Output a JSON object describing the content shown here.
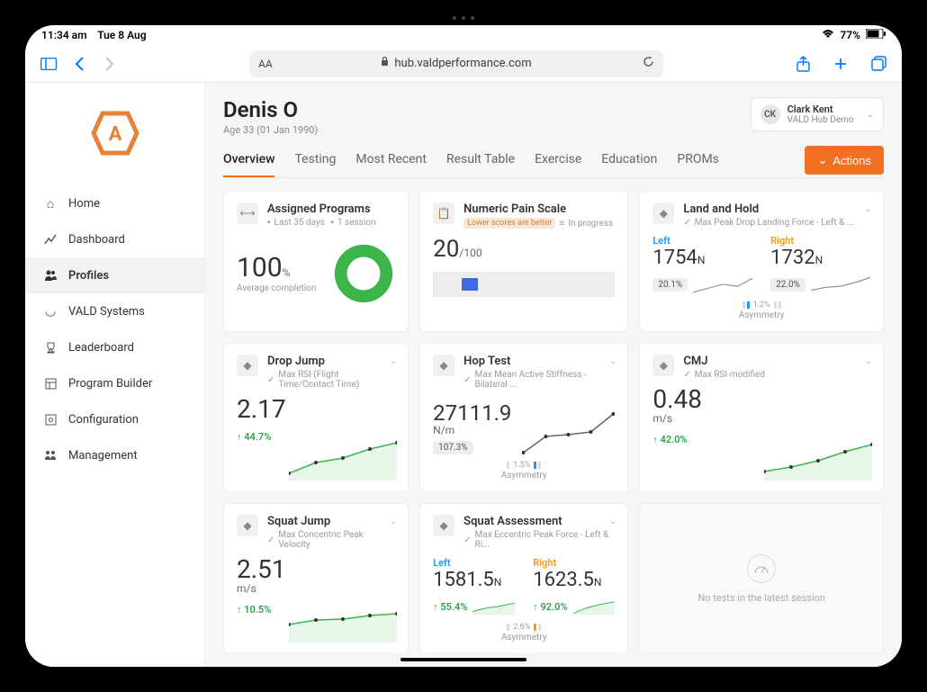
{
  "status": {
    "time": "11:34 am",
    "date": "Tue 8 Aug",
    "battery": "77%"
  },
  "browser": {
    "url": "hub.valdperformance.com",
    "aa": "AA"
  },
  "sidebar": {
    "items": [
      {
        "label": "Home",
        "icon": "home"
      },
      {
        "label": "Dashboard",
        "icon": "chart"
      },
      {
        "label": "Profiles",
        "icon": "user",
        "active": true
      },
      {
        "label": "VALD Systems",
        "icon": "device"
      },
      {
        "label": "Leaderboard",
        "icon": "trophy"
      },
      {
        "label": "Program Builder",
        "icon": "layout"
      },
      {
        "label": "Configuration",
        "icon": "gear"
      },
      {
        "label": "Management",
        "icon": "people"
      }
    ]
  },
  "header": {
    "profile_name": "Denis O",
    "age_line": "Age  33 (01 Jan 1990)",
    "user": {
      "initials": "CK",
      "name": "Clark Kent",
      "sub": "VALD Hub Demo"
    }
  },
  "tabs": [
    "Overview",
    "Testing",
    "Most Recent",
    "Result Table",
    "Exercise",
    "Education",
    "PROMs"
  ],
  "actions_label": "Actions",
  "cards": {
    "assigned": {
      "title": "Assigned Programs",
      "sub1": "Last 35 days",
      "sub2": "1 session",
      "value": "100",
      "unit": "%",
      "avg": "Average completion"
    },
    "pain": {
      "title": "Numeric Pain Scale",
      "sub1": "Lower scores are better",
      "sub2": "In progress",
      "score": "20",
      "max": "/100"
    },
    "land": {
      "title": "Land and Hold",
      "sub": "Max Peak Drop Landing Force - Left & ...",
      "left_label": "Left",
      "left_val": "1754",
      "left_unit": "N",
      "left_pct": "20.1%",
      "right_label": "Right",
      "right_val": "1732",
      "right_unit": "N",
      "right_pct": "22.0%",
      "asym": "1.2%",
      "asym_label": "Asymmetry"
    },
    "drop": {
      "title": "Drop Jump",
      "sub": "Max RSI (Flight Time/Contact Time)",
      "val": "2.17",
      "change": "↑ 44.7%"
    },
    "hop": {
      "title": "Hop Test",
      "sub": "Max Mean Active Stiffness - Bilateral ...",
      "val": "27111.9",
      "unit": "N/m",
      "pill": "107.3%",
      "asym": "1.5%",
      "asym_label": "Asymmetry"
    },
    "cmj": {
      "title": "CMJ",
      "sub": "Max RSI-modified",
      "val": "0.48",
      "unit": "m/s",
      "change": "↑ 42.0%"
    },
    "squatjump": {
      "title": "Squat Jump",
      "sub": "Max Concentric Peak Velocity",
      "val": "2.51",
      "unit": "m/s",
      "change": "↑ 10.5%"
    },
    "squatassess": {
      "title": "Squat Assessment",
      "sub": "Max Eccentric Peak Force - Left & Ri...",
      "left_label": "Left",
      "left_val": "1581.5",
      "left_unit": "N",
      "left_change": "↑ 55.4%",
      "right_label": "Right",
      "right_val": "1623.5",
      "right_unit": "N",
      "right_change": "↑ 92.0%",
      "asym": "2.6%",
      "asym_label": "Asymmetry"
    },
    "empty": {
      "text": "No tests in the latest session"
    }
  }
}
